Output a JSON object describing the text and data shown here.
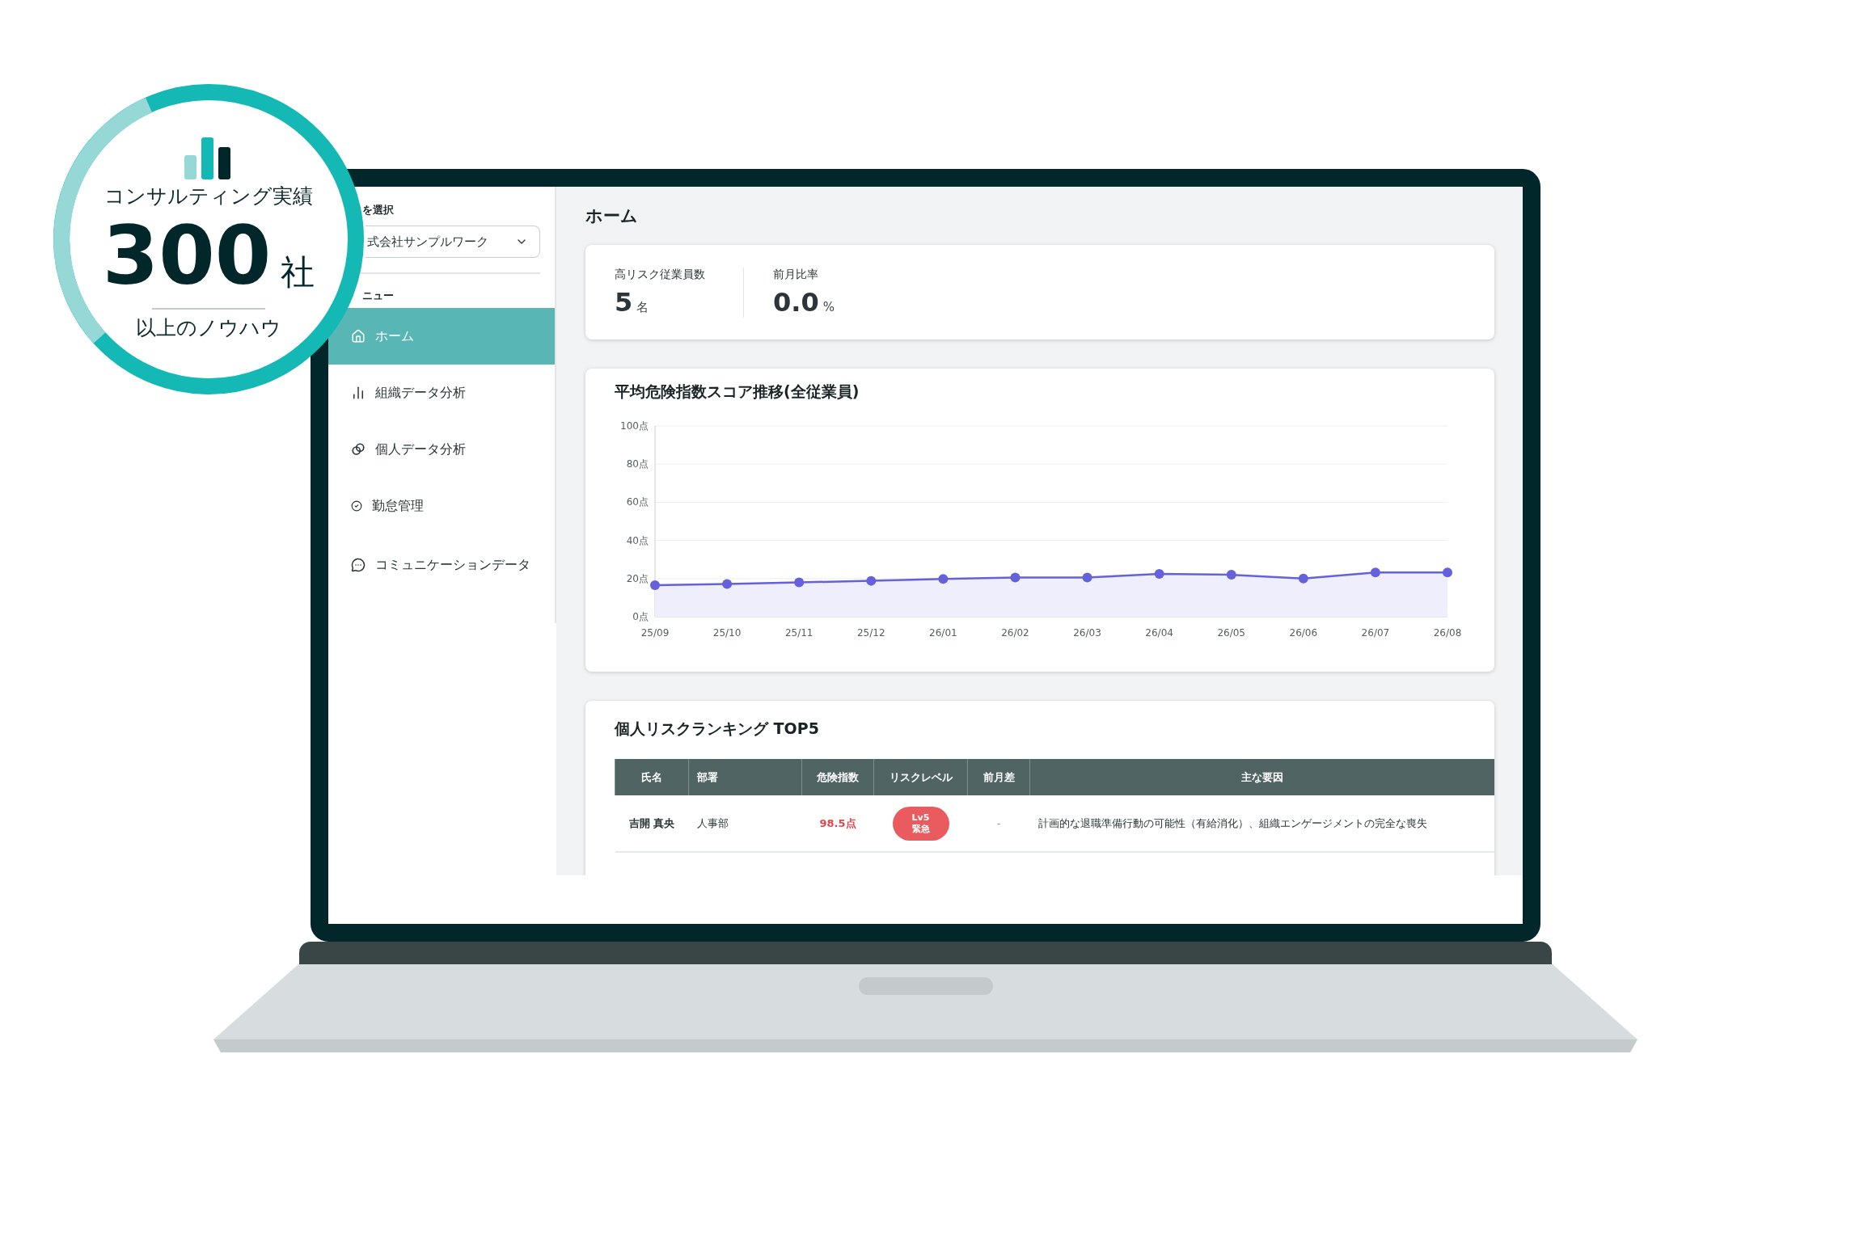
{
  "promo_badge": {
    "caption": "コンサルティング実績",
    "number": "300",
    "unit": "社",
    "subcaption": "以上のノウハウ"
  },
  "sidebar": {
    "org_label": "を選択",
    "org_select": {
      "value": "式会社サンプルワーク"
    },
    "menu_label": "ニュー",
    "items": [
      {
        "label": "ホーム",
        "selected": true
      },
      {
        "label": "組織データ分析",
        "selected": false
      },
      {
        "label": "個人データ分析",
        "selected": false
      },
      {
        "label": "勤怠管理",
        "selected": false
      },
      {
        "label": "コミュニケーションデータ",
        "selected": false
      }
    ]
  },
  "main": {
    "title": "ホーム",
    "stats": [
      {
        "label": "高リスク従業員数",
        "value": "5",
        "unit": "名"
      },
      {
        "label": "前月比率",
        "value": "0.0",
        "unit": "%"
      }
    ],
    "trend": {
      "title": "平均危険指数スコア推移(全従業員)",
      "chart_data": {
        "type": "area",
        "categories": [
          "25/09",
          "25/10",
          "25/11",
          "25/12",
          "26/01",
          "26/02",
          "26/03",
          "26/04",
          "26/05",
          "26/06",
          "26/07",
          "26/08"
        ],
        "values": [
          16.5,
          17.2,
          18,
          18.8,
          19.8,
          20.6,
          20.6,
          22.5,
          22,
          20,
          23.2,
          23.2
        ],
        "grid": true,
        "ylim": [
          0,
          100
        ],
        "yticks": [
          {
            "value": 0,
            "label": "0点"
          },
          {
            "value": 20,
            "label": "20点"
          },
          {
            "value": 40,
            "label": "40点"
          },
          {
            "value": 60,
            "label": "60点"
          },
          {
            "value": 80,
            "label": "80点"
          },
          {
            "value": 100,
            "label": "100点"
          }
        ]
      }
    },
    "ranking": {
      "title": "個人リスクランキング TOP5",
      "columns": [
        "氏名",
        "部署",
        "危険指数",
        "リスクレベル",
        "前月差",
        "主な要因"
      ],
      "rows": [
        {
          "name": "吉開 真央",
          "department": "人事部",
          "score": "98.5点",
          "level": "Lv5",
          "level_label": "緊急",
          "change": "-",
          "factors": "計画的な退職準備行動の可能性（有給消化）、組織エンゲージメントの完全な喪失"
        }
      ]
    }
  }
}
